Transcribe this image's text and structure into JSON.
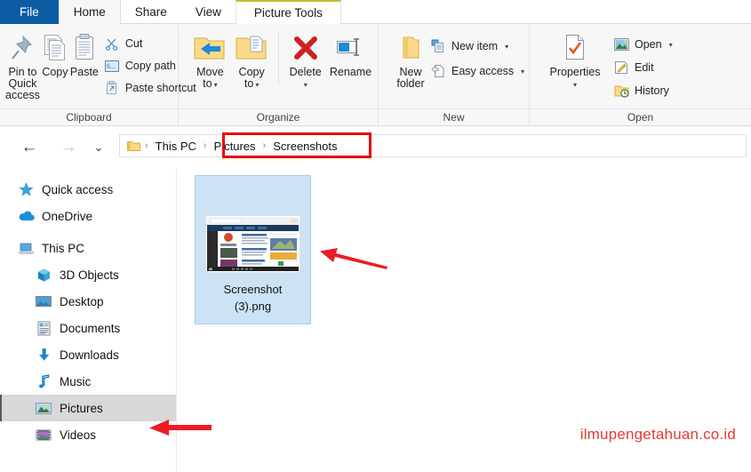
{
  "window": {
    "tabs": [
      {
        "id": "file",
        "label": "File",
        "style": "file"
      },
      {
        "id": "home",
        "label": "Home",
        "style": "active"
      },
      {
        "id": "share",
        "label": "Share",
        "style": "normal"
      },
      {
        "id": "view",
        "label": "View",
        "style": "normal"
      },
      {
        "id": "picture-tools",
        "label": "Picture Tools",
        "style": "contextual"
      }
    ]
  },
  "ribbon": {
    "groups": [
      {
        "name": "Clipboard",
        "label": "Clipboard",
        "big": [
          {
            "label_line1": "Pin to Quick",
            "label_line2": "access",
            "icon": "pin-icon"
          },
          {
            "label_line1": "Copy",
            "label_line2": "",
            "icon": "copy-icon"
          },
          {
            "label_line1": "Paste",
            "label_line2": "",
            "icon": "paste-icon"
          }
        ],
        "small": [
          {
            "label": "Cut",
            "icon": "scissors-icon"
          },
          {
            "label": "Copy path",
            "icon": "copy-path-icon"
          },
          {
            "label": "Paste shortcut",
            "icon": "paste-shortcut-icon"
          }
        ]
      },
      {
        "name": "Organize",
        "label": "Organize",
        "big": [
          {
            "label_line1": "Move",
            "label_line2": "to",
            "icon": "move-to-icon",
            "dropdown": true
          },
          {
            "label_line1": "Copy",
            "label_line2": "to",
            "icon": "copy-to-icon",
            "dropdown": true
          },
          {
            "label_line1": "Delete",
            "label_line2": "",
            "icon": "delete-icon",
            "dropdown_below": true
          },
          {
            "label_line1": "Rename",
            "label_line2": "",
            "icon": "rename-icon"
          }
        ]
      },
      {
        "name": "New",
        "label": "New",
        "big": [
          {
            "label_line1": "New",
            "label_line2": "folder",
            "icon": "new-folder-icon"
          }
        ],
        "small": [
          {
            "label": "New item",
            "icon": "new-item-icon",
            "dropdown": true
          },
          {
            "label": "Easy access",
            "icon": "easy-access-icon",
            "dropdown": true
          }
        ]
      },
      {
        "name": "Open",
        "label": "Open",
        "big": [
          {
            "label_line1": "Properties",
            "label_line2": "",
            "icon": "properties-icon",
            "dropdown_below": true
          }
        ],
        "small": [
          {
            "label": "Open",
            "icon": "open-picture-icon",
            "dropdown": true
          },
          {
            "label": "Edit",
            "icon": "edit-icon"
          },
          {
            "label": "History",
            "icon": "history-icon"
          }
        ]
      }
    ]
  },
  "addressbar": {
    "back_icon": "back-arrow-icon",
    "forward_icon": "forward-arrow-icon",
    "recent_icon": "chevron-down-icon",
    "up_icon": "up-arrow-icon",
    "folder_icon": "folder-icon",
    "crumbs": [
      "This PC",
      "Pictures",
      "Screenshots"
    ],
    "separator": "›",
    "highlight_color": "#e8050a"
  },
  "sidebar": {
    "items": [
      {
        "label": "Quick access",
        "icon": "star-icon",
        "level": 0,
        "selected": false
      },
      {
        "label": "OneDrive",
        "icon": "cloud-icon",
        "level": 0,
        "selected": false
      },
      {
        "label": "This PC",
        "icon": "computer-icon",
        "level": 0,
        "selected": false
      },
      {
        "label": "3D Objects",
        "icon": "3d-objects-icon",
        "level": 1,
        "selected": false
      },
      {
        "label": "Desktop",
        "icon": "desktop-icon",
        "level": 1,
        "selected": false
      },
      {
        "label": "Documents",
        "icon": "documents-icon",
        "level": 1,
        "selected": false
      },
      {
        "label": "Downloads",
        "icon": "downloads-icon",
        "level": 1,
        "selected": false
      },
      {
        "label": "Music",
        "icon": "music-icon",
        "level": 1,
        "selected": false
      },
      {
        "label": "Pictures",
        "icon": "pictures-icon",
        "level": 1,
        "selected": true
      },
      {
        "label": "Videos",
        "icon": "videos-icon",
        "level": 1,
        "selected": false
      }
    ]
  },
  "content": {
    "file": {
      "name_line1": "Screenshot",
      "name_line2": "(3).png",
      "thumbnail": "browser-screenshot-thumbnail",
      "selected": true
    }
  },
  "annotations": {
    "arrow_to_file": "red-arrow-left",
    "arrow_to_pictures": "red-arrow-left",
    "watermark": "ilmupengetahuan.co.id",
    "watermark_color": "#e23b32"
  }
}
